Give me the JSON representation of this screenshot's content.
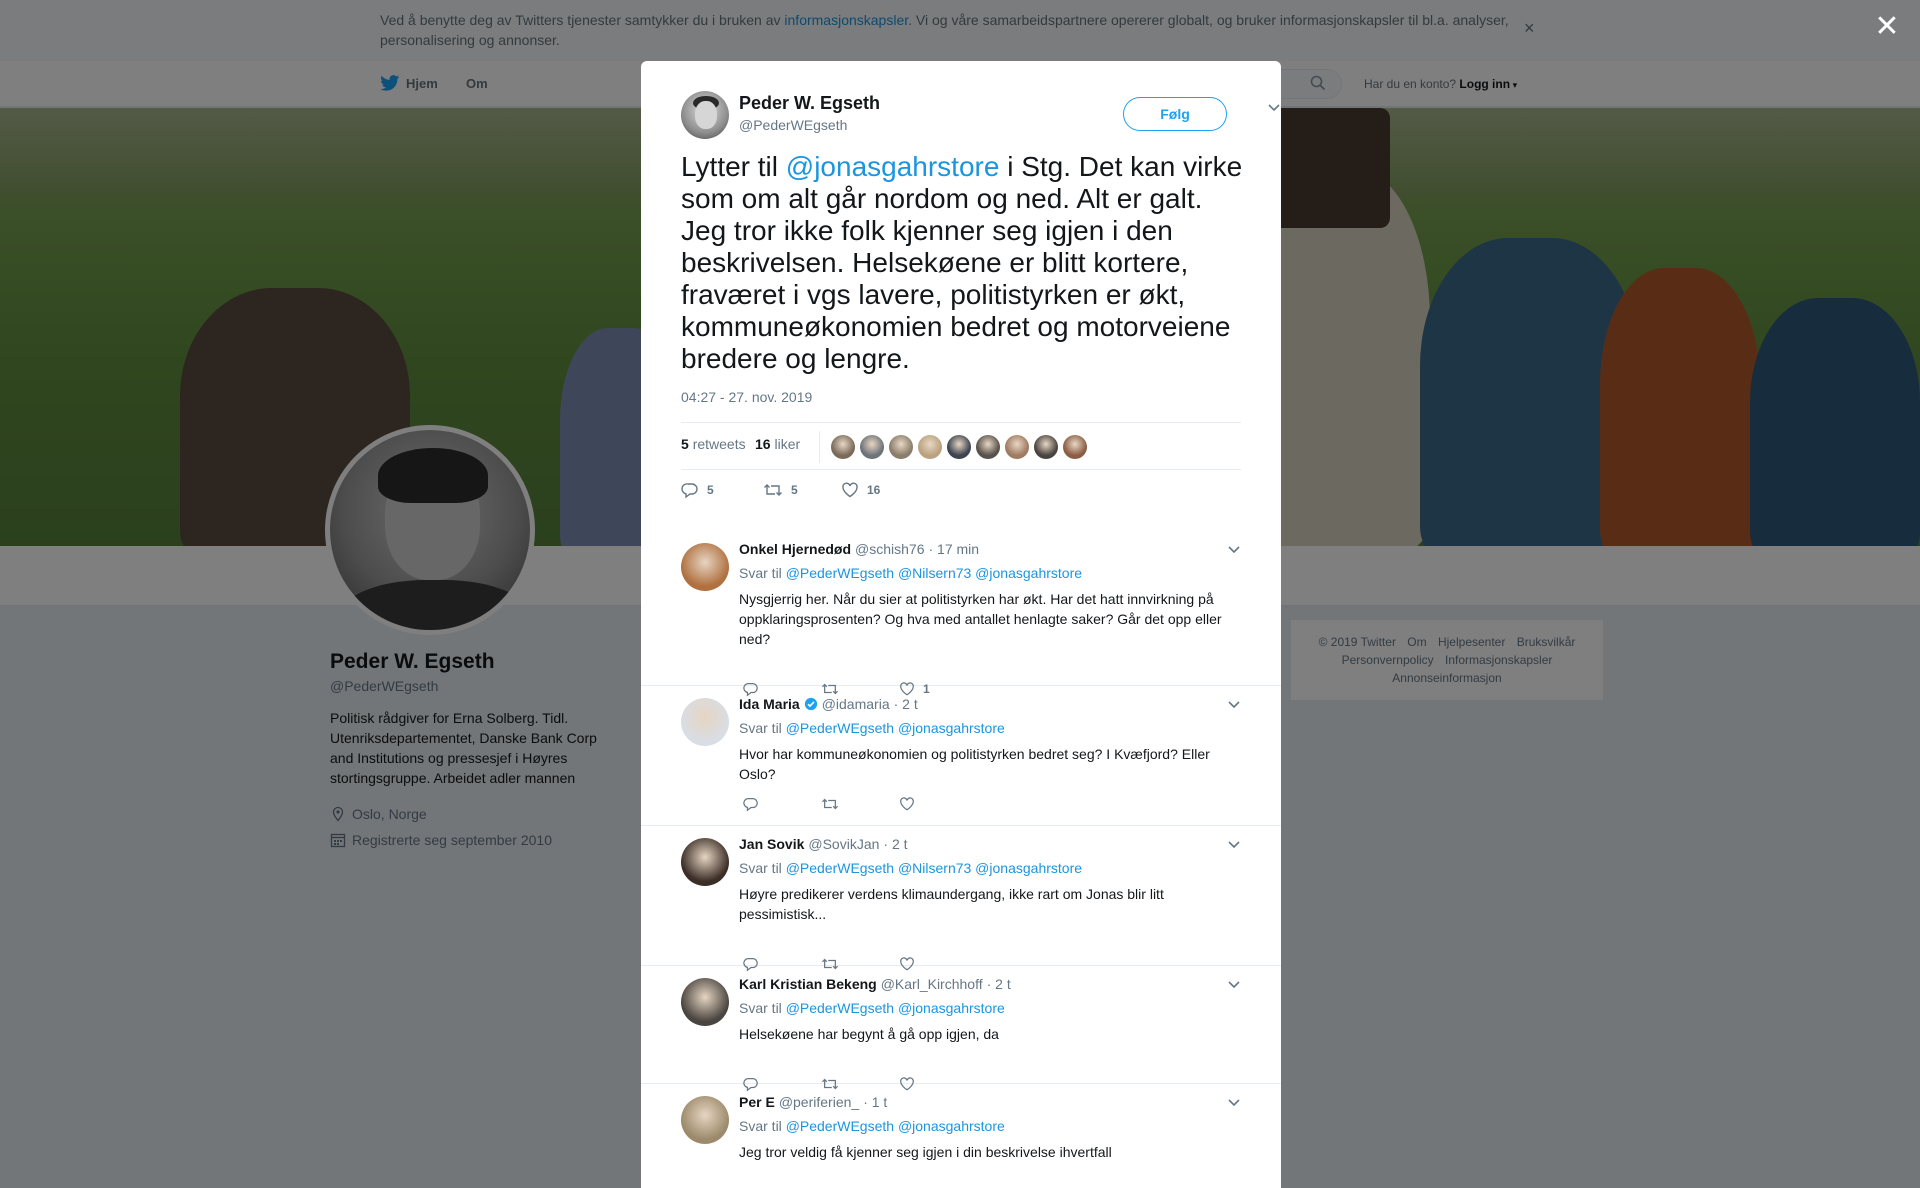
{
  "cookie_banner": {
    "text_before": "Ved å benytte deg av Twitters tjenester samtykker du i bruken av ",
    "link_text": "informasjonskapsler",
    "text_after": ". Vi og våre samarbeidspartnere opererer globalt, og bruker informasjonskapsler til bl.a. analyser, personalisering og annonser.",
    "close_label": "×"
  },
  "nav": {
    "home_label": "Hjem",
    "about_label": "Om",
    "account_prompt": "Har du en konto?",
    "login_label": "Logg inn"
  },
  "profile": {
    "name": "Peder W. Egseth",
    "handle": "@PederWEgseth",
    "bio": "Politisk rådgiver for Erna Solberg. Tidl. Utenriksdepartementet, Danske Bank Corp and Institutions og pressesjef i Høyres stortingsgruppe. Arbeidet adler mannen",
    "location": "Oslo, Norge",
    "joined": "Registrerte seg september 2010"
  },
  "footer": {
    "links": [
      "© 2019 Twitter",
      "Om",
      "Hjelpesenter",
      "Bruksvilkår",
      "Personvernpolicy",
      "Informasjonskapsler",
      "Annonseinformasjon"
    ]
  },
  "overlay": {
    "close_label": "✕"
  },
  "tweet": {
    "author_name": "Peder W. Egseth",
    "author_handle": "@PederWEgseth",
    "follow_label": "Følg",
    "text_before": "Lytter til ",
    "mention": "@jonasgahrstore",
    "text_after": " i Stg. Det kan virke som om alt går nordom og ned. Alt er galt. Jeg tror ikke folk kjenner seg igjen i den beskrivelsen. Helsekøene er blitt kortere, fraværet i vgs lavere, politistyrken er økt, kommuneøkonomien bedret og motorveiene bredere og lengre.",
    "timestamp": "04:27 - 27. nov. 2019",
    "retweets_count": "5",
    "retweets_label": "retweets",
    "likes_count": "16",
    "likes_label": "liker",
    "reply_count": "5",
    "retweet_count_action": "5",
    "like_count_action": "16",
    "liker_colors": [
      "#7a6a5a",
      "#6e7378",
      "#8a7d6b",
      "#b9a27e",
      "#3d4450",
      "#58524c",
      "#a07a62",
      "#4a4440",
      "#8b5e45"
    ]
  },
  "replies": [
    {
      "name": "Onkel Hjernedød",
      "handle": "@schish76",
      "time": "· 17 min",
      "verified": false,
      "reply_prefix": "Svar til",
      "reply_to": "@PederWEgseth @Nilsern73 @jonasgahrstore",
      "text": "Nysgjerrig her. Når du sier at politistyrken har økt. Har det hatt innvirkning på oppklaringsprosenten? Og hva med antallet henlagte saker? Går det opp eller ned?",
      "like_count": "1",
      "avatar_color": "#b0703f"
    },
    {
      "name": "Ida Maria",
      "handle": "@idamaria",
      "time": "· 2 t",
      "verified": true,
      "reply_prefix": "Svar til",
      "reply_to": "@PederWEgseth @jonasgahrstore",
      "text": "Hvor har kommuneøkonomien og politistyrken bedret seg? I Kvæfjord? Eller Oslo?",
      "like_count": "",
      "avatar_color": "#d9dde4"
    },
    {
      "name": "Jan Sovik",
      "handle": "@SovikJan",
      "time": "· 2 t",
      "verified": false,
      "reply_prefix": "Svar til",
      "reply_to": "@PederWEgseth @Nilsern73 @jonasgahrstore",
      "text": "Høyre predikerer verdens klimaundergang, ikke rart om Jonas blir litt pessimistisk...",
      "like_count": "",
      "avatar_color": "#3b2e27"
    },
    {
      "name": "Karl Kristian Bekeng",
      "handle": "@Karl_Kirchhoff",
      "time": "· 2 t",
      "verified": false,
      "reply_prefix": "Svar til",
      "reply_to": "@PederWEgseth @jonasgahrstore",
      "text": "Helsekøene har begynt å gå opp igjen, da",
      "like_count": "",
      "avatar_color": "#4a4540"
    },
    {
      "name": "Per E",
      "handle": "@periferien_",
      "time": "· 1 t",
      "verified": false,
      "reply_prefix": "Svar til",
      "reply_to": "@PederWEgseth @jonasgahrstore",
      "text": "Jeg tror veldig få kjenner seg igjen i din beskrivelse ihvertfall",
      "like_count": "",
      "avatar_color": "#9c8a6b"
    }
  ],
  "colors": {
    "accent": "#1da1f2",
    "link": "#1b95e0",
    "muted": "#657786"
  }
}
